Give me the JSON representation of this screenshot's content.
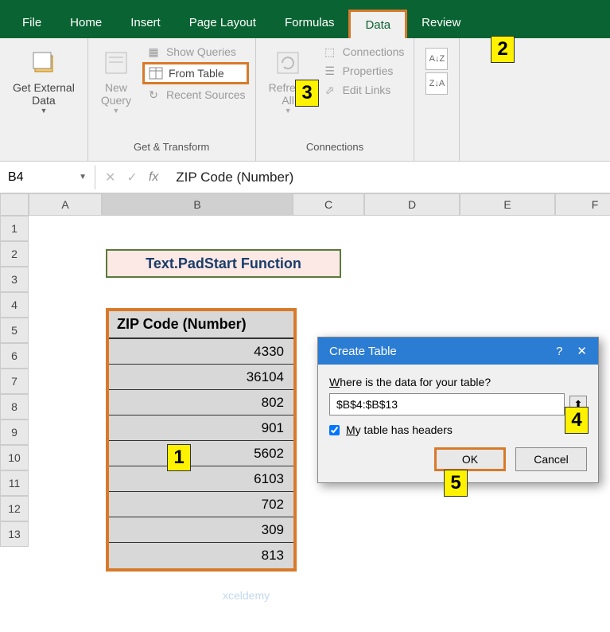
{
  "menu": {
    "file": "File",
    "home": "Home",
    "insert": "Insert",
    "page_layout": "Page Layout",
    "formulas": "Formulas",
    "data": "Data",
    "review": "Review"
  },
  "ribbon": {
    "get_external": "Get External\nData",
    "new_query": "New\nQuery",
    "show_queries": "Show Queries",
    "from_table": "From Table",
    "recent_sources": "Recent Sources",
    "get_transform": "Get & Transform",
    "refresh_all": "Refresh\nAll",
    "connections_btn": "Connections",
    "properties": "Properties",
    "edit_links": "Edit Links",
    "connections_label": "Connections"
  },
  "namebox": "B4",
  "formula_bar": "ZIP Code (Number)",
  "columns": [
    "A",
    "B",
    "C",
    "D",
    "E",
    "F"
  ],
  "rows": [
    "1",
    "2",
    "3",
    "4",
    "5",
    "6",
    "7",
    "8",
    "9",
    "10",
    "11",
    "12",
    "13"
  ],
  "title_cell": "Text.PadStart Function",
  "table": {
    "header": "ZIP Code (Number)",
    "values": [
      "4330",
      "36104",
      "802",
      "901",
      "5602",
      "6103",
      "702",
      "309",
      "813"
    ]
  },
  "dialog": {
    "title": "Create Table",
    "help": "?",
    "close": "✕",
    "question": "Where is the data for your table?",
    "range": "$B$4:$B$13",
    "headers_label": "My table has headers",
    "ok": "OK",
    "cancel": "Cancel"
  },
  "annotations": {
    "a1": "1",
    "a2": "2",
    "a3": "3",
    "a4": "4",
    "a5": "5"
  },
  "watermark": "xceldemy"
}
